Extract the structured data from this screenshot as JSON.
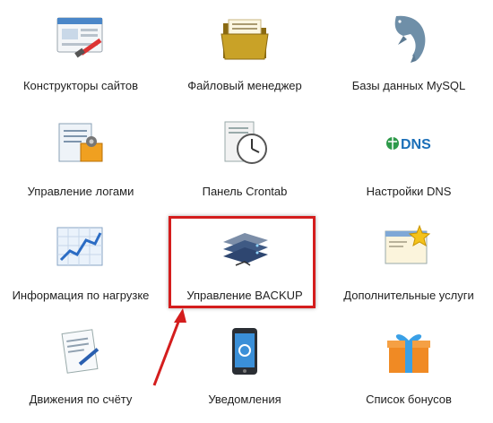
{
  "grid": [
    {
      "label": "Конструкторы сайтов",
      "icon": "website-builder-icon"
    },
    {
      "label": "Файловый менеджер",
      "icon": "folder-icon"
    },
    {
      "label": "Базы данных MySQL",
      "icon": "mysql-dolphin-icon"
    },
    {
      "label": "Управление логами",
      "icon": "logs-icon"
    },
    {
      "label": "Панель Crontab",
      "icon": "clock-icon"
    },
    {
      "label": "Настройки DNS",
      "icon": "dns-icon"
    },
    {
      "label": "Информация по нагрузке",
      "icon": "chart-icon"
    },
    {
      "label": "Управление BACKUP",
      "icon": "server-backup-icon"
    },
    {
      "label": "Дополнительные услуги",
      "icon": "window-stars-icon"
    },
    {
      "label": "Движения по счёту",
      "icon": "document-pen-icon"
    },
    {
      "label": "Уведомления",
      "icon": "smartphone-icon"
    },
    {
      "label": "Список бонусов",
      "icon": "gift-icon"
    }
  ],
  "dns_icon_text": "DNS",
  "colors": {
    "highlight": "#d41d1d",
    "arrow": "#d41d1d"
  }
}
